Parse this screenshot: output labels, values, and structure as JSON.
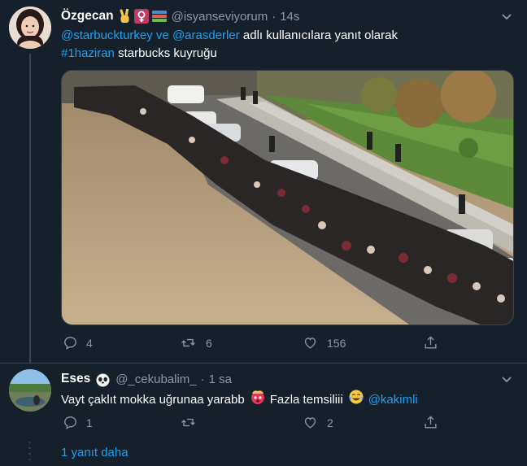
{
  "colors": {
    "background": "#15202b",
    "text": "#ffffff",
    "muted": "#8899a6",
    "link": "#1da1f2",
    "thread_line": "#38444d"
  },
  "tweet1": {
    "display_name": "Özgecan",
    "name_emojis": [
      "victory-hand",
      "female-sign",
      "books"
    ],
    "handle": "@isyanseviyorum",
    "separator": "·",
    "time": "14s",
    "reply_mention_1": "@starbuckturkey",
    "reply_and": "ve",
    "reply_mention_2": "@arasderler",
    "reply_suffix": "adlı kullanıcılara yanıt olarak",
    "hashtag": "#1haziran",
    "text": "starbucks kuyruğu",
    "actions": {
      "replies": "4",
      "retweets": "6",
      "likes": "156"
    }
  },
  "tweet2": {
    "display_name": "Eses",
    "name_emoji": "panda-face",
    "handle": "@_cekubalim_",
    "separator": "·",
    "time": "1 sa",
    "text": "Vayt çaklıt mokka uğrunaa yarabb",
    "emoji_1": "exploding-face",
    "text_2": "Fazla temsiliii",
    "emoji_2": "tears-of-joy-face",
    "mention": "@kakimli",
    "actions": {
      "replies": "1",
      "retweets": "",
      "likes": "2"
    }
  },
  "more_replies": "1 yanıt daha"
}
